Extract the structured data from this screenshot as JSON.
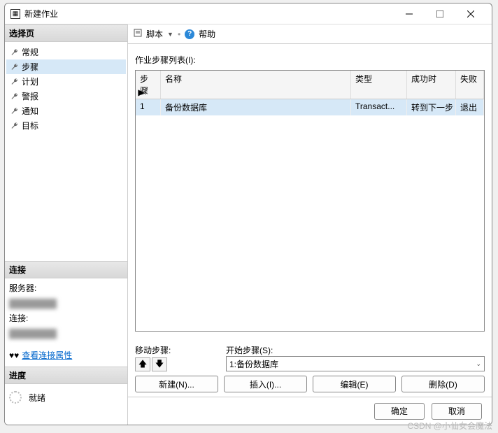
{
  "window": {
    "title": "新建作业"
  },
  "sidebar": {
    "select_page": "选择页",
    "items": [
      {
        "label": "常规"
      },
      {
        "label": "步骤"
      },
      {
        "label": "计划"
      },
      {
        "label": "警报"
      },
      {
        "label": "通知"
      },
      {
        "label": "目标"
      }
    ],
    "connection": "连接",
    "server_label": "服务器:",
    "conn_label": "连接:",
    "view_conn_props": "查看连接属性",
    "progress": "进度",
    "ready": "就绪"
  },
  "toolbar": {
    "script": "脚本",
    "help": "帮助"
  },
  "list_label": "作业步骤列表(I):",
  "columns": {
    "step": "步骤",
    "name": "名称",
    "type": "类型",
    "success": "成功时",
    "fail": "失败"
  },
  "rows": [
    {
      "step": "1",
      "name": "备份数据库",
      "type": "Transact...",
      "success": "转到下一步",
      "fail": "退出"
    }
  ],
  "move_step": "移动步骤:",
  "start_step_label": "开始步骤(S):",
  "start_step_value": "1:备份数据库",
  "buttons": {
    "new": "新建(N)...",
    "insert": "插入(I)...",
    "edit": "编辑(E)",
    "delete": "删除(D)"
  },
  "footer": {
    "ok": "确定",
    "cancel": "取消"
  },
  "watermark": "CSDN @小仙女会魔法"
}
